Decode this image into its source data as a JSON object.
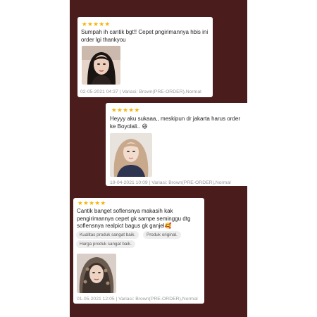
{
  "reviews": [
    {
      "stars": "★★★★★",
      "text": "Sumpah ih cantik bgt!! Cepet pngirimannya hbis ini order lgi thankyou",
      "meta": "02-05-2021 04:37 | Variasi: Brown(PRE-ORDER),Normal",
      "photo_icon": "woman-portrait-photo"
    },
    {
      "stars": "★★★★★",
      "text": "Heyyy aku sukaaa,, meskipun dr jakarta harus order ke Boyolali.. 😆",
      "meta": "19-04-2021 10:09 | Variasi: Brown(PRE-ORDER),Normal",
      "photo_icon": "woman-portrait-photo"
    },
    {
      "stars": "★★★★★",
      "text": "Cantik banget soflensnya makasih kak pengirimannya cepet gk sampe seminggu dtg soflensnya realpict bagus gk ganjel🥰",
      "tags": [
        "Kualitas produk sangat baik.",
        "Produk original.",
        "Harga produk sangat baik."
      ],
      "meta": "01-05-2021 12:05 | Variasi: Brown(PRE-ORDER),Normal",
      "photo_icon": "woman-hijab-portrait-photo"
    }
  ],
  "colors": {
    "background": "#4a1c1c",
    "card": "#ffffff",
    "star": "#f5b301",
    "meta_text": "#9a9a9a",
    "tag_background": "#eeeeee"
  }
}
